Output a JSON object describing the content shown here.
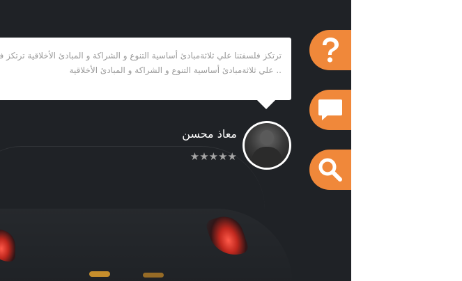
{
  "testimonial": {
    "line1": "ترتكز فلسفتنا علي ثلاثةمبادئ أساسية التنوع و الشراكة و المبادئ الأخلاقية ترتكز فلسفتنا",
    "line2": ".. علي ثلاثةمبادئ أساسية التنوع و الشراكة و المبادئ الأخلاقية",
    "author_name": "معاذ محسن",
    "rating_stars": "★★★★★",
    "rating": 5
  },
  "side_buttons": [
    {
      "icon": "question-icon",
      "color": "#f0883a"
    },
    {
      "icon": "chat-bubble-icon",
      "color": "#f0883a"
    },
    {
      "icon": "search-icon",
      "color": "#f0883a"
    }
  ]
}
